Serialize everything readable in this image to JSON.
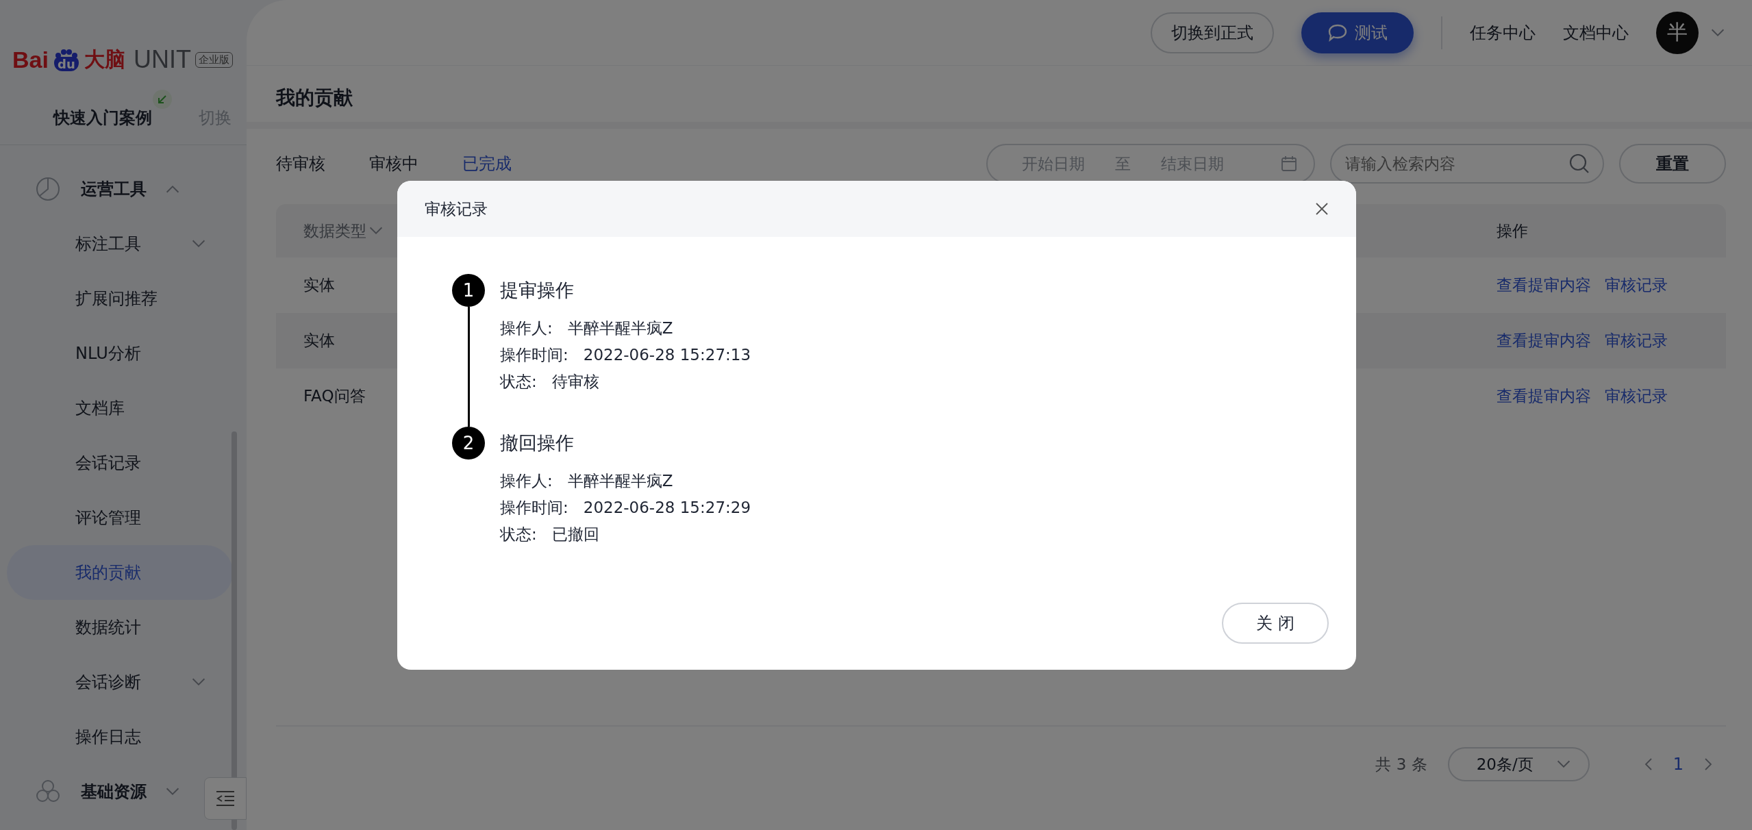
{
  "logo": {
    "brand_left": "Bai",
    "brand_mark": "du",
    "brand_cn": "大脑",
    "product": "UNIT",
    "edition": "企业版"
  },
  "project": {
    "name": "快速入门案例",
    "switch": "切换"
  },
  "menu": [
    {
      "label": "运营工具",
      "expanded": true,
      "selected": false,
      "children": [
        {
          "label": "标注工具",
          "expanded": false,
          "selected": false
        },
        {
          "label": "扩展问推荐",
          "selected": false
        },
        {
          "label": "NLU分析",
          "selected": false
        },
        {
          "label": "文档库",
          "selected": false
        },
        {
          "label": "会话记录",
          "selected": false
        },
        {
          "label": "评论管理",
          "selected": false
        },
        {
          "label": "我的贡献",
          "selected": true
        },
        {
          "label": "数据统计",
          "selected": false
        },
        {
          "label": "会话诊断",
          "expanded": false,
          "selected": false
        },
        {
          "label": "操作日志",
          "selected": false
        }
      ]
    },
    {
      "label": "基础资源",
      "expanded": false,
      "selected": false
    }
  ],
  "topbar": {
    "switch_button": "切换到正式",
    "test_button": "测试",
    "links": [
      "任务中心",
      "文档中心"
    ],
    "avatar": "半"
  },
  "page_title": "我的贡献",
  "tabs": [
    {
      "label": "待审核",
      "selected": false
    },
    {
      "label": "审核中",
      "selected": false
    },
    {
      "label": "已完成",
      "selected": true
    }
  ],
  "date_range": {
    "start_placeholder": "开始日期",
    "separator": "至",
    "end_placeholder": "结束日期"
  },
  "search": {
    "placeholder": "请输入检索内容"
  },
  "reset_button": "重置",
  "table": {
    "columns": [
      "数据类型",
      "操作"
    ],
    "rows": [
      {
        "type": "实体",
        "actions": [
          "查看提审内容",
          "审核记录"
        ]
      },
      {
        "type": "实体",
        "actions": [
          "查看提审内容",
          "审核记录"
        ]
      },
      {
        "type": "FAQ问答",
        "actions": [
          "查看提审内容",
          "审核记录"
        ]
      }
    ]
  },
  "pagination": {
    "total": "共 3 条",
    "page_size": "20条/页",
    "pages": [
      {
        "label": "1",
        "selected": true
      }
    ]
  },
  "dialog": {
    "title": "审核记录",
    "steps": [
      {
        "number": "1",
        "title": "提审操作",
        "fields": [
          {
            "label": "操作人:",
            "value": "半醉半醒半疯Z"
          },
          {
            "label": "操作时间:",
            "value": "2022-06-28 15:27:13"
          },
          {
            "label": "状态:",
            "value": "待审核"
          }
        ]
      },
      {
        "number": "2",
        "title": "撤回操作",
        "fields": [
          {
            "label": "操作人:",
            "value": "半醉半醒半疯Z"
          },
          {
            "label": "操作时间:",
            "value": "2022-06-28 15:27:29"
          },
          {
            "label": "状态:",
            "value": "已撤回"
          }
        ]
      }
    ],
    "close_button": "关 闭"
  }
}
